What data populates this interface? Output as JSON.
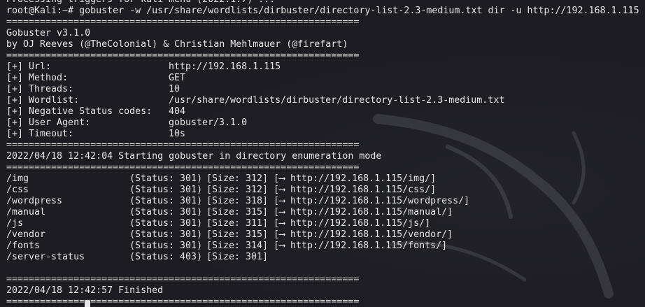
{
  "terminal": {
    "top_partial": "Processing triggers for kali-menu (2022.1.7) ...",
    "command_line": "root@Kali:~# gobuster -w /usr/share/wordlists/dirbuster/directory-list-2.3-medium.txt dir -u http://192.168.1.115",
    "separator": "===============================================================",
    "banner": [
      "Gobuster v3.1.0",
      "by OJ Reeves (@TheColonial) & Christian Mehlmauer (@firefart)"
    ],
    "config": [
      {
        "key": "[+] Url:",
        "value": "http://192.168.1.115"
      },
      {
        "key": "[+] Method:",
        "value": "GET"
      },
      {
        "key": "[+] Threads:",
        "value": "10"
      },
      {
        "key": "[+] Wordlist:",
        "value": "/usr/share/wordlists/dirbuster/directory-list-2.3-medium.txt"
      },
      {
        "key": "[+] Negative Status codes:",
        "value": "404"
      },
      {
        "key": "[+] User Agent:",
        "value": "gobuster/3.1.0"
      },
      {
        "key": "[+] Timeout:",
        "value": "10s"
      }
    ],
    "start_message": "2022/04/18 12:42:04 Starting gobuster in directory enumeration mode",
    "results": [
      {
        "path": "/img",
        "status": "(Status: 301)",
        "size": "[Size: 312]",
        "redirect": "[⟶ http://192.168.1.115/img/]"
      },
      {
        "path": "/css",
        "status": "(Status: 301)",
        "size": "[Size: 312]",
        "redirect": "[⟶ http://192.168.1.115/css/]"
      },
      {
        "path": "/wordpress",
        "status": "(Status: 301)",
        "size": "[Size: 318]",
        "redirect": "[⟶ http://192.168.1.115/wordpress/]"
      },
      {
        "path": "/manual",
        "status": "(Status: 301)",
        "size": "[Size: 315]",
        "redirect": "[⟶ http://192.168.1.115/manual/]"
      },
      {
        "path": "/js",
        "status": "(Status: 301)",
        "size": "[Size: 311]",
        "redirect": "[⟶ http://192.168.1.115/js/]"
      },
      {
        "path": "/vendor",
        "status": "(Status: 301)",
        "size": "[Size: 315]",
        "redirect": "[⟶ http://192.168.1.115/vendor/]"
      },
      {
        "path": "/fonts",
        "status": "(Status: 301)",
        "size": "[Size: 314]",
        "redirect": "[⟶ http://192.168.1.115/fonts/]"
      },
      {
        "path": "/server-status",
        "status": "(Status: 403)",
        "size": "[Size: 301]",
        "redirect": ""
      }
    ],
    "finish_message": "2022/04/18 12:42:57 Finished"
  },
  "colors": {
    "background": "#1c1c22",
    "text": "#e6e6e6"
  }
}
